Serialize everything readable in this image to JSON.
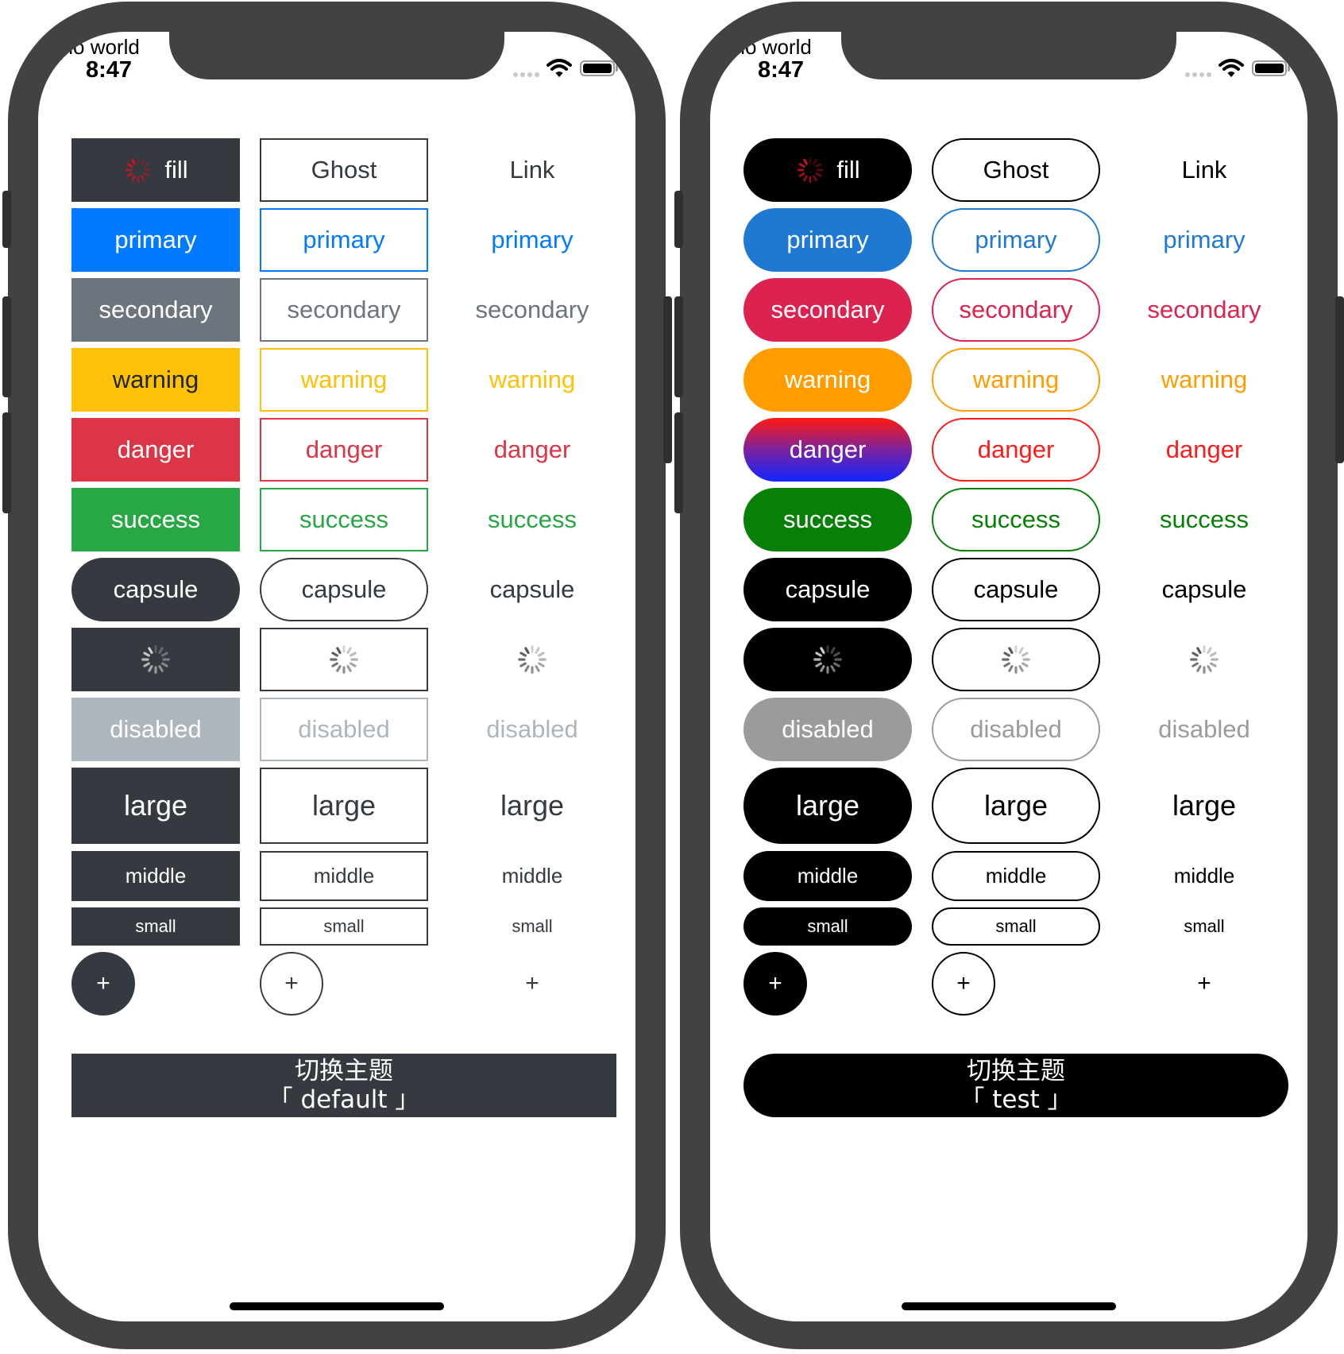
{
  "status_bar": {
    "label": "ello world",
    "time": "8:47"
  },
  "columns": [
    "Fill",
    "Ghost",
    "Link"
  ],
  "rows": [
    {
      "key": "fill",
      "labels": [
        "fill",
        "Ghost",
        "Link"
      ],
      "loading_first": true,
      "size": "normal",
      "variant": "dark"
    },
    {
      "key": "primary",
      "labels": [
        "primary",
        "primary",
        "primary"
      ],
      "size": "normal",
      "variant": "primary"
    },
    {
      "key": "secondary",
      "labels": [
        "secondary",
        "secondary",
        "secondary"
      ],
      "size": "normal",
      "variant": "secondary"
    },
    {
      "key": "warning",
      "labels": [
        "warning",
        "warning",
        "warning"
      ],
      "size": "normal",
      "variant": "warning"
    },
    {
      "key": "danger",
      "labels": [
        "danger",
        "danger",
        "danger"
      ],
      "size": "normal",
      "variant": "danger"
    },
    {
      "key": "success",
      "labels": [
        "success",
        "success",
        "success"
      ],
      "size": "normal",
      "variant": "success"
    },
    {
      "key": "capsule",
      "labels": [
        "capsule",
        "capsule",
        "capsule"
      ],
      "size": "normal",
      "variant": "dark",
      "capsule": true
    },
    {
      "key": "loading",
      "labels": [
        "",
        "",
        ""
      ],
      "loading": true,
      "size": "normal",
      "variant": "dark"
    },
    {
      "key": "disabled",
      "labels": [
        "disabled",
        "disabled",
        "disabled"
      ],
      "size": "normal",
      "variant": "disabled"
    },
    {
      "key": "large",
      "labels": [
        "large",
        "large",
        "large"
      ],
      "size": "large",
      "variant": "dark"
    },
    {
      "key": "middle",
      "labels": [
        "middle",
        "middle",
        "middle"
      ],
      "size": "middle",
      "variant": "dark"
    },
    {
      "key": "small",
      "labels": [
        "small",
        "small",
        "small"
      ],
      "size": "small",
      "variant": "dark"
    }
  ],
  "fab": {
    "label": "+"
  },
  "themes": [
    {
      "name": "default",
      "switch_label_line1": "切换主题",
      "switch_label_line2": "「 default 」",
      "rounded": false,
      "colors": {
        "dark": "#343a40",
        "primary": "#007bff",
        "secondary": "#6c757d",
        "warning": "#ffc107",
        "danger": "#dc3545",
        "success": "#28a745",
        "disabled": "#adb5bd",
        "warning_fill_text": "#212529",
        "spinner_accent": "#d0121e"
      }
    },
    {
      "name": "test",
      "switch_label_line1": "切换主题",
      "switch_label_line2": "「 test 」",
      "rounded": true,
      "colors": {
        "dark": "#000000",
        "primary": "#1f78d1",
        "secondary": "#dc2350",
        "warning": "#ff9d00",
        "danger": "#ff1a1a",
        "danger_gradient": [
          "#ff1a10",
          "#7b22a0",
          "#1026ff"
        ],
        "success": "#088008",
        "disabled": "#9b9b9b",
        "warning_fill_text": "#ffffff",
        "spinner_accent": "#d0121e"
      }
    }
  ]
}
